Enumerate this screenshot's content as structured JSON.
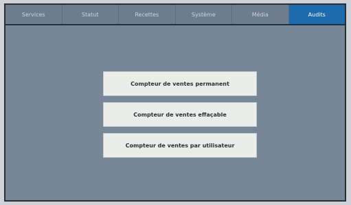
{
  "tabs": [
    {
      "label": "Services"
    },
    {
      "label": "Statut"
    },
    {
      "label": "Recettes"
    },
    {
      "label": "Système"
    },
    {
      "label": "Média"
    },
    {
      "label": "Audits"
    }
  ],
  "active_tab": "Audits",
  "buttons": {
    "permanent": "Compteur de ventes permanent",
    "effacable": "Compteur de ventes effaçable",
    "par_utilisateur": "Compteur de ventes par utilisateur"
  },
  "colors": {
    "background": "#778799",
    "active_tab": "#1d6aad",
    "button": "#ebedea"
  }
}
